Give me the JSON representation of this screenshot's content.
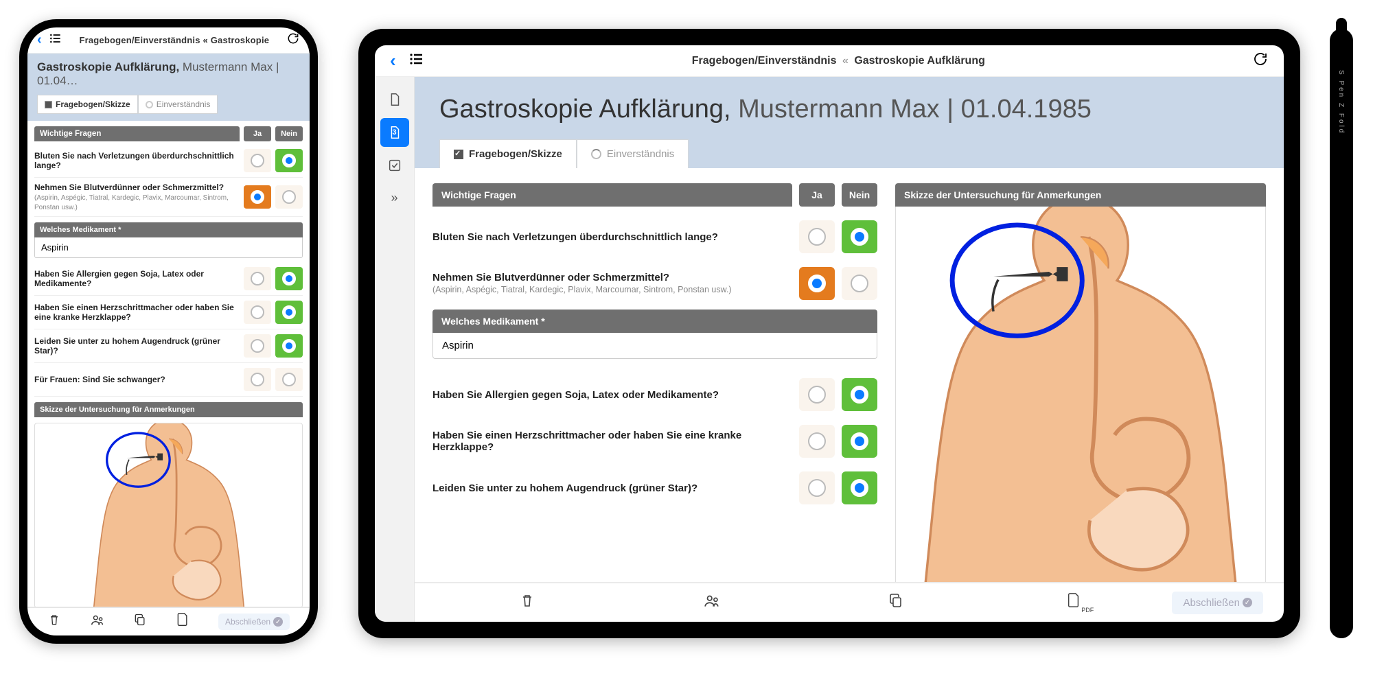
{
  "phone": {
    "breadcrumb": "Fragebogen/Einverständnis  «  Gastroskopie",
    "title_bold": "Gastroskopie Aufklärung,",
    "title_rest": " Mustermann Max | 01.04…",
    "tabs": {
      "t1": "Fragebogen/Skizze",
      "t2": "Einverständnis"
    },
    "section": "Wichtige Fragen",
    "ja": "Ja",
    "nein": "Nein",
    "q1": "Bluten Sie nach Verletzungen überdurchschnittlich lange?",
    "q2": "Nehmen Sie Blutverdünner oder Schmerzmittel?",
    "q2s": "(Aspirin, Aspégic, Tiatral, Kardegic, Plavix, Marcoumar, Sintrom, Ponstan usw.)",
    "medh": "Welches Medikament *",
    "medv": "Aspirin",
    "q3": "Haben Sie Allergien gegen Soja, Latex oder Medikamente?",
    "q4": "Haben Sie einen Herzschrittmacher oder haben Sie eine kranke Herzklappe?",
    "q5": "Leiden Sie unter zu hohem Augendruck (grüner Star)?",
    "q6": "Für Frauen: Sind Sie schwanger?",
    "skz": "Skizze der Untersuchung für Anmerkungen",
    "abs": "Abschließen"
  },
  "tablet": {
    "crumb_a": "Fragebogen/Einverständnis",
    "crumb_sep": "«",
    "crumb_b": "Gastroskopie Aufklärung",
    "side_num": "3",
    "title_bold": "Gastroskopie Aufklärung,",
    "title_rest": " Mustermann Max | 01.04.1985",
    "tabs": {
      "t1": "Fragebogen/Skizze",
      "t2": "Einverständnis"
    },
    "section": "Wichtige Fragen",
    "ja": "Ja",
    "nein": "Nein",
    "q1": "Bluten Sie nach Verletzungen überdurchschnittlich lange?",
    "q2": "Nehmen Sie Blutverdünner oder Schmerzmittel?",
    "q2s": "(Aspirin, Aspégic, Tiatral, Kardegic, Plavix, Marcoumar, Sintrom, Ponstan usw.)",
    "medh": "Welches Medikament *",
    "medv": "Aspirin",
    "q3": "Haben Sie Allergien gegen Soja, Latex oder Medikamente?",
    "q4": "Haben Sie einen Herzschrittmacher oder haben Sie eine kranke Herzklappe?",
    "q5": "Leiden Sie unter zu hohem Augendruck (grüner Star)?",
    "skz": "Skizze der Untersuchung für Anmerkungen",
    "pdf": "PDF",
    "abs": "Abschließen"
  },
  "stylus": "S Pen   Z Fold"
}
